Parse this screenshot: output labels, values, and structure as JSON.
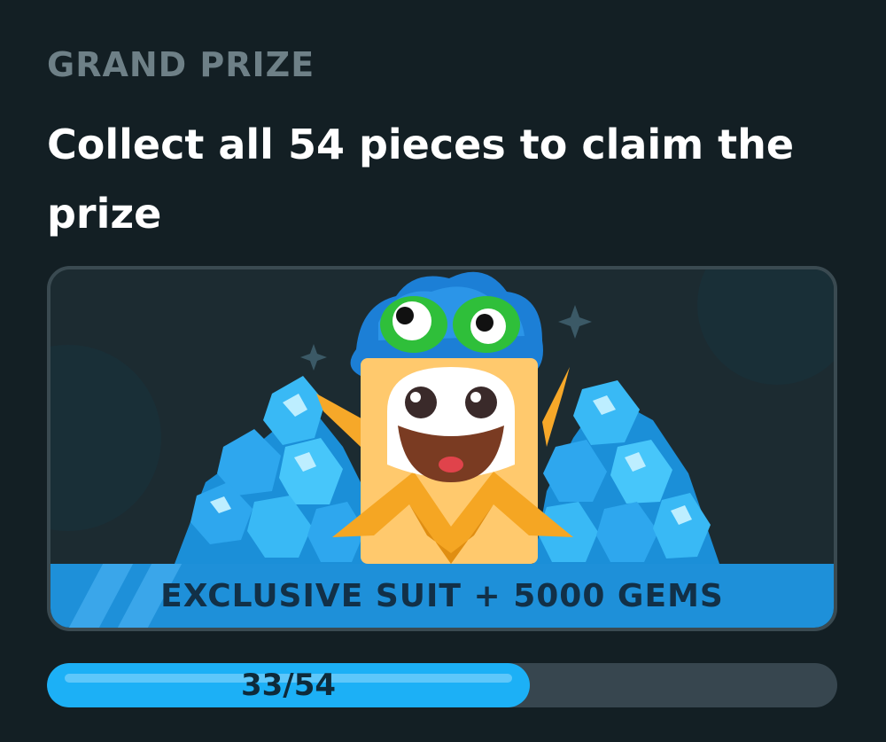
{
  "header": {
    "eyebrow": "GRAND PRIZE",
    "title": "Collect all 54 pieces to claim the prize"
  },
  "prize_card": {
    "banner_label": "EXCLUSIVE SUIT + 5000 GEMS",
    "illustration": "mascot-in-suit-with-gem-piles"
  },
  "progress": {
    "current": 33,
    "total": 54,
    "label": "33/54"
  },
  "colors": {
    "background": "#131f24",
    "eyebrow": "#6e8087",
    "accent_blue": "#1cb0f6",
    "banner_blue": "#1e90d9",
    "track": "#37464f"
  }
}
